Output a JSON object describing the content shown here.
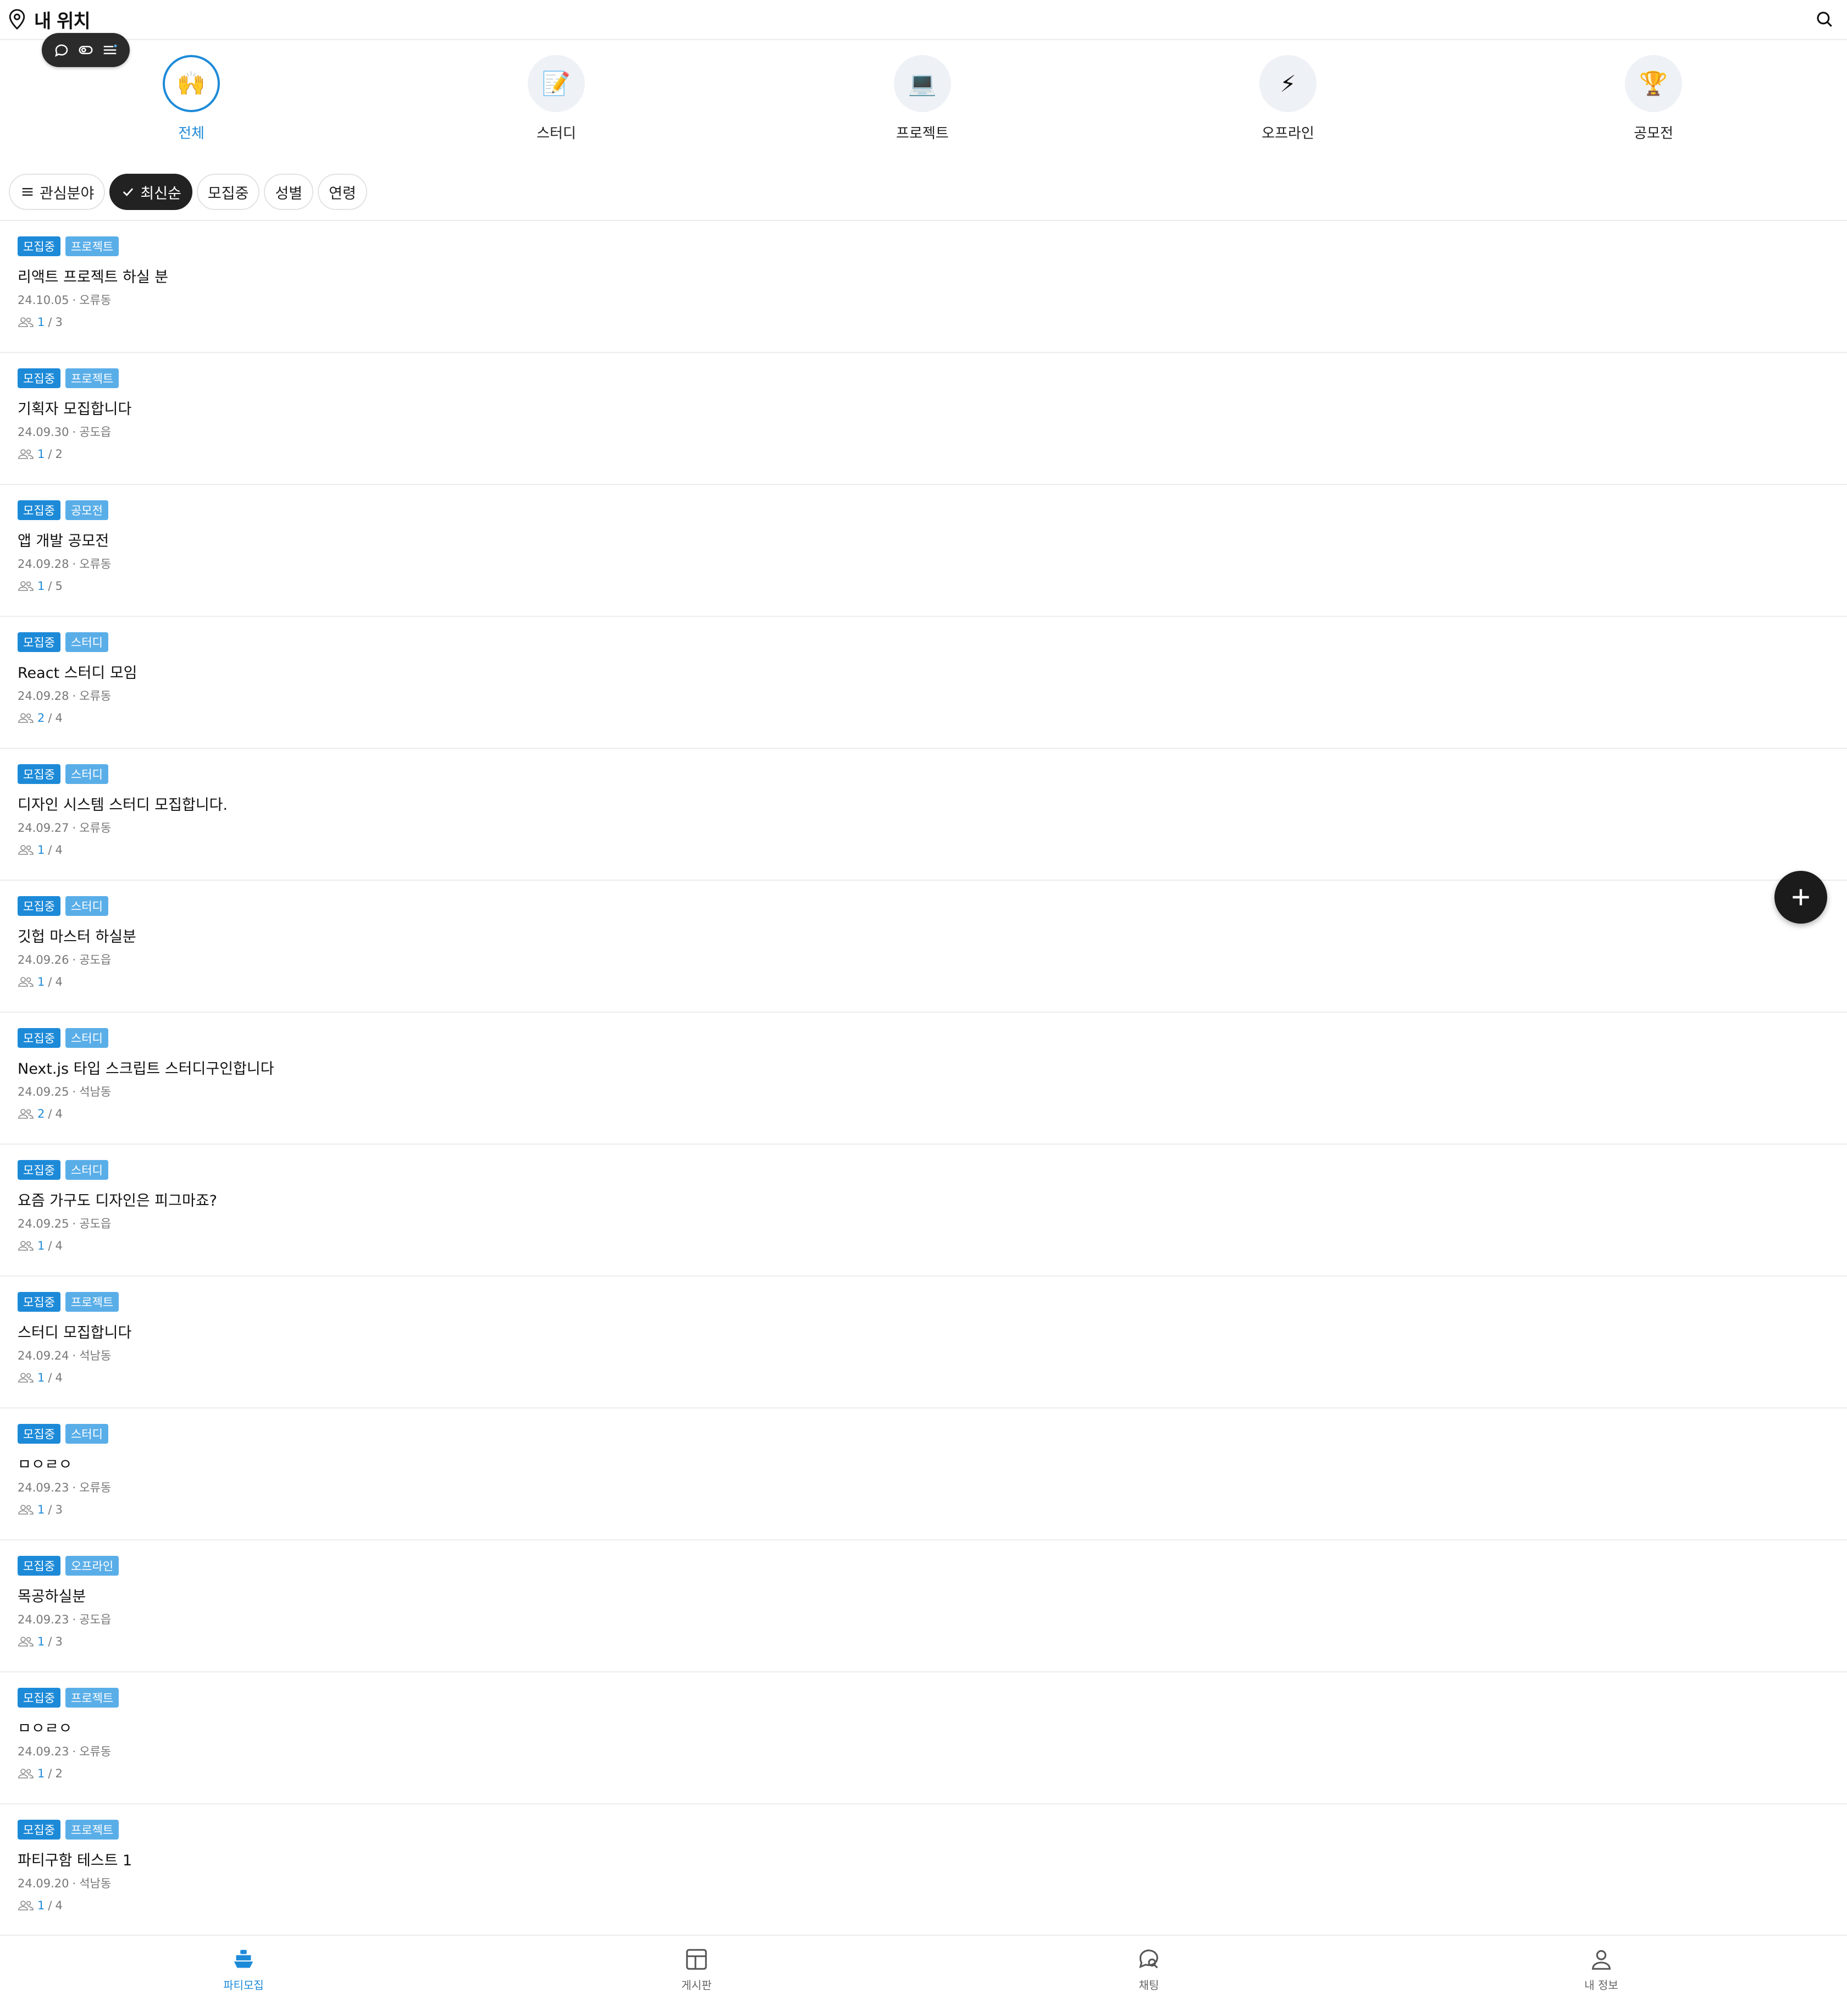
{
  "header": {
    "title": "내 위치",
    "location_icon": "map-pin-icon",
    "search_icon": "search-icon"
  },
  "devbar": {
    "icons": [
      "chat-bubble-icon",
      "toggle-icon",
      "list-settings-icon"
    ]
  },
  "categories": [
    {
      "label": "전체",
      "emoji": "🙌",
      "active": true
    },
    {
      "label": "스터디",
      "emoji": "📝",
      "active": false
    },
    {
      "label": "프로젝트",
      "emoji": "💻",
      "active": false
    },
    {
      "label": "오프라인",
      "emoji": "⚡",
      "active": false
    },
    {
      "label": "공모전",
      "emoji": "🏆",
      "active": false
    }
  ],
  "filters": [
    {
      "label": "관심분야",
      "icon": "menu-icon",
      "selected": false
    },
    {
      "label": "최신순",
      "icon": "check-icon",
      "selected": true
    },
    {
      "label": "모집중",
      "selected": false
    },
    {
      "label": "성별",
      "selected": false
    },
    {
      "label": "연령",
      "selected": false
    }
  ],
  "posts": [
    {
      "status": "모집중",
      "kind": "프로젝트",
      "title": "리액트 프로젝트 하실 분",
      "date": "24.10.05",
      "location": "오류동",
      "current": "1",
      "total": "3"
    },
    {
      "status": "모집중",
      "kind": "프로젝트",
      "title": "기획자 모집합니다",
      "date": "24.09.30",
      "location": "공도읍",
      "current": "1",
      "total": "2"
    },
    {
      "status": "모집중",
      "kind": "공모전",
      "title": "앱 개발 공모전",
      "date": "24.09.28",
      "location": "오류동",
      "current": "1",
      "total": "5"
    },
    {
      "status": "모집중",
      "kind": "스터디",
      "title": "React 스터디 모임",
      "date": "24.09.28",
      "location": "오류동",
      "current": "2",
      "total": "4"
    },
    {
      "status": "모집중",
      "kind": "스터디",
      "title": "디자인 시스템 스터디 모집합니다.",
      "date": "24.09.27",
      "location": "오류동",
      "current": "1",
      "total": "4"
    },
    {
      "status": "모집중",
      "kind": "스터디",
      "title": "깃헙 마스터 하실분",
      "date": "24.09.26",
      "location": "공도읍",
      "current": "1",
      "total": "4"
    },
    {
      "status": "모집중",
      "kind": "스터디",
      "title": "Next.js 타입 스크립트 스터디구인합니다",
      "date": "24.09.25",
      "location": "석남동",
      "current": "2",
      "total": "4"
    },
    {
      "status": "모집중",
      "kind": "스터디",
      "title": "요즘 가구도 디자인은 피그마죠?",
      "date": "24.09.25",
      "location": "공도읍",
      "current": "1",
      "total": "4"
    },
    {
      "status": "모집중",
      "kind": "프로젝트",
      "title": "스터디 모집합니다",
      "date": "24.09.24",
      "location": "석남동",
      "current": "1",
      "total": "4"
    },
    {
      "status": "모집중",
      "kind": "스터디",
      "title": "ㅁㅇㄹㅇ",
      "date": "24.09.23",
      "location": "오류동",
      "current": "1",
      "total": "3"
    },
    {
      "status": "모집중",
      "kind": "오프라인",
      "title": "목공하실분",
      "date": "24.09.23",
      "location": "공도읍",
      "current": "1",
      "total": "3"
    },
    {
      "status": "모집중",
      "kind": "프로젝트",
      "title": "ㅁㅇㄹㅇ",
      "date": "24.09.23",
      "location": "오류동",
      "current": "1",
      "total": "2"
    },
    {
      "status": "모집중",
      "kind": "프로젝트",
      "title": "파티구함 테스트 1",
      "date": "24.09.20",
      "location": "석남동",
      "current": "1",
      "total": "4"
    }
  ],
  "fab": {
    "icon": "plus-icon"
  },
  "bottom_nav": [
    {
      "label": "파티모집",
      "icon": "party-boat-icon",
      "active": true
    },
    {
      "label": "게시판",
      "icon": "board-icon",
      "active": false
    },
    {
      "label": "채팅",
      "icon": "chat-search-icon",
      "active": false
    },
    {
      "label": "내 정보",
      "icon": "user-icon",
      "active": false
    }
  ],
  "colors": {
    "accent": "#1d8ad8",
    "tag_light": "#5aaee8",
    "dark": "#222222"
  }
}
